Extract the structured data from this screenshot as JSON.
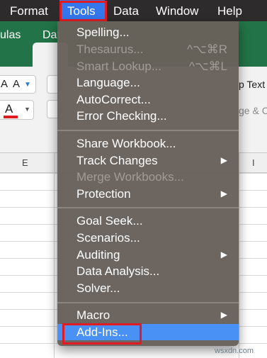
{
  "menubar": {
    "items": [
      {
        "label": "Format"
      },
      {
        "label": "Tools"
      },
      {
        "label": "Data"
      },
      {
        "label": "Window"
      },
      {
        "label": "Help"
      }
    ]
  },
  "excel": {
    "tabs": [
      "ulas",
      "Dat"
    ],
    "ribbon": {
      "font_size_up": "A",
      "font_size_down": "A",
      "font_color": "A",
      "wrap_text": "p Text",
      "merge_center": "ge & C"
    },
    "columns": [
      "E",
      "I"
    ]
  },
  "menu": {
    "items": [
      {
        "label": "Spelling...",
        "state": "enabled",
        "shortcut": ""
      },
      {
        "label": "Thesaurus...",
        "state": "disabled",
        "shortcut": "^⌥⌘R"
      },
      {
        "label": "Smart Lookup...",
        "state": "disabled",
        "shortcut": "^⌥⌘L"
      },
      {
        "label": "Language...",
        "state": "enabled",
        "shortcut": ""
      },
      {
        "label": "AutoCorrect...",
        "state": "enabled",
        "shortcut": ""
      },
      {
        "label": "Error Checking...",
        "state": "enabled",
        "shortcut": ""
      },
      {
        "label": "Share Workbook...",
        "state": "enabled",
        "shortcut": ""
      },
      {
        "label": "Track Changes",
        "state": "enabled",
        "submenu": true
      },
      {
        "label": "Merge Workbooks...",
        "state": "disabled",
        "shortcut": ""
      },
      {
        "label": "Protection",
        "state": "enabled",
        "submenu": true
      },
      {
        "label": "Goal Seek...",
        "state": "enabled",
        "shortcut": ""
      },
      {
        "label": "Scenarios...",
        "state": "enabled",
        "shortcut": ""
      },
      {
        "label": "Auditing",
        "state": "enabled",
        "submenu": true
      },
      {
        "label": "Data Analysis...",
        "state": "enabled",
        "shortcut": ""
      },
      {
        "label": "Solver...",
        "state": "enabled",
        "shortcut": ""
      },
      {
        "label": "Macro",
        "state": "enabled",
        "submenu": true
      },
      {
        "label": "Add-Ins...",
        "state": "highlighted",
        "shortcut": ""
      }
    ],
    "submenu_arrow": "▶"
  },
  "watermark": "wsxdn.com",
  "colors": {
    "menubar_bg": "#2d2b2c",
    "menubar_active": "#3477ed",
    "excel_green": "#227448",
    "menu_bg": "#68615b",
    "menu_highlight": "#4a91f5",
    "callout_red": "#e11b22"
  }
}
